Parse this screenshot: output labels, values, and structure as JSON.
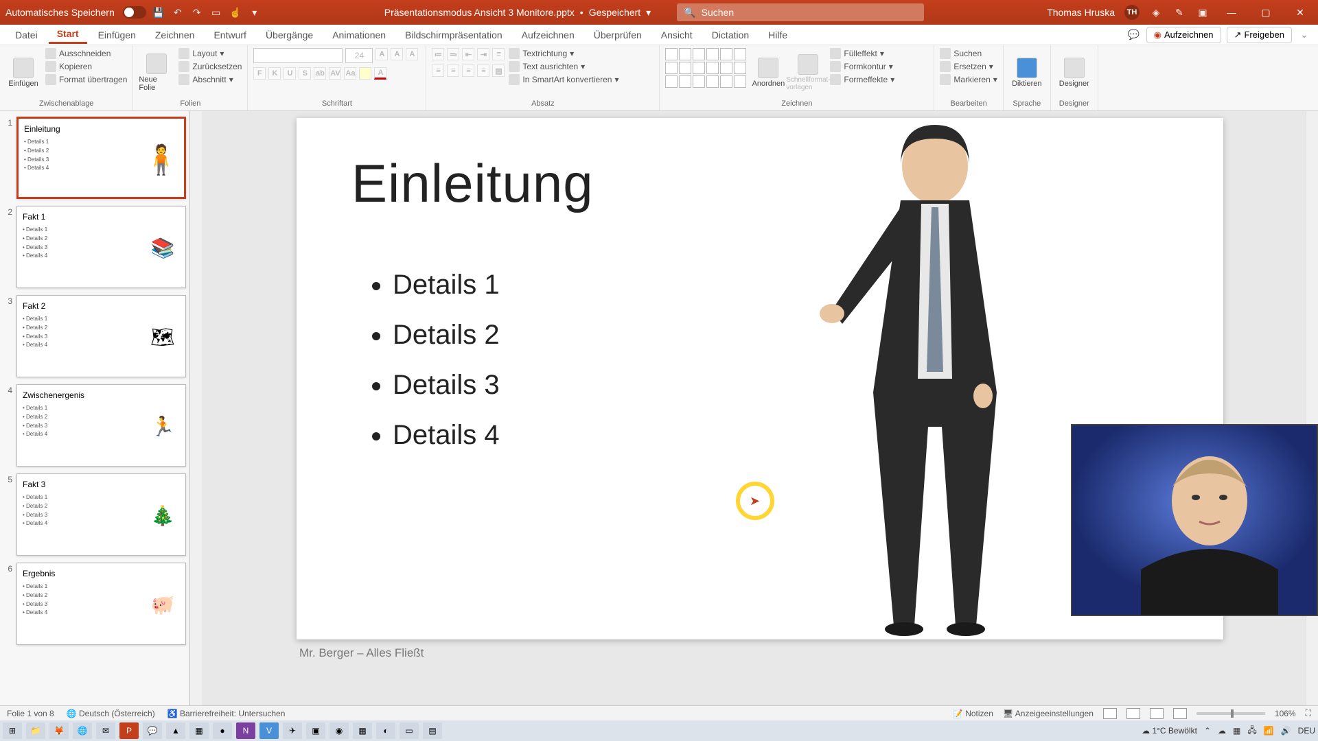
{
  "titlebar": {
    "autosave_label": "Automatisches Speichern",
    "filename": "Präsentationsmodus Ansicht 3 Monitore.pptx",
    "saved_status": "Gespeichert",
    "search_placeholder": "Suchen",
    "user_name": "Thomas Hruska",
    "user_initials": "TH"
  },
  "menu": {
    "tabs": [
      "Datei",
      "Start",
      "Einfügen",
      "Zeichnen",
      "Entwurf",
      "Übergänge",
      "Animationen",
      "Bildschirmpräsentation",
      "Aufzeichnen",
      "Überprüfen",
      "Ansicht",
      "Dictation",
      "Hilfe"
    ],
    "active_index": 1,
    "record": "Aufzeichnen",
    "share": "Freigeben"
  },
  "ribbon": {
    "clipboard": {
      "paste": "Einfügen",
      "cut": "Ausschneiden",
      "copy": "Kopieren",
      "format": "Format übertragen",
      "label": "Zwischenablage"
    },
    "slides": {
      "new": "Neue Folie",
      "layout": "Layout",
      "reset": "Zurücksetzen",
      "section": "Abschnitt",
      "label": "Folien"
    },
    "font": {
      "size": "24",
      "label": "Schriftart"
    },
    "paragraph": {
      "textdir": "Textrichtung",
      "align": "Text ausrichten",
      "smartart": "In SmartArt konvertieren",
      "label": "Absatz"
    },
    "drawing": {
      "arrange": "Anordnen",
      "quickstyles": "Schnellformat-vorlagen",
      "fill": "Fülleffekt",
      "outline": "Formkontur",
      "effects": "Formeffekte",
      "label": "Zeichnen"
    },
    "editing": {
      "find": "Suchen",
      "replace": "Ersetzen",
      "select": "Markieren",
      "label": "Bearbeiten"
    },
    "voice": {
      "dictate": "Diktieren",
      "label": "Sprache"
    },
    "designer": {
      "designer": "Designer",
      "label": "Designer"
    }
  },
  "thumbnails": [
    {
      "num": "1",
      "title": "Einleitung",
      "bullets": [
        "Details 1",
        "Details 2",
        "Details 3",
        "Details 4"
      ],
      "icon": "person"
    },
    {
      "num": "2",
      "title": "Fakt 1",
      "bullets": [
        "Details 1",
        "Details 2",
        "Details 3",
        "Details 4"
      ],
      "icon": "stack"
    },
    {
      "num": "3",
      "title": "Fakt 2",
      "bullets": [
        "Details 1",
        "Details 2",
        "Details 3",
        "Details 4"
      ],
      "icon": "map"
    },
    {
      "num": "4",
      "title": "Zwischenergenis",
      "bullets": [
        "Details 1",
        "Details 2",
        "Details 3",
        "Details 4"
      ],
      "icon": "runner"
    },
    {
      "num": "5",
      "title": "Fakt 3",
      "bullets": [
        "Details 1",
        "Details 2",
        "Details 3",
        "Details 4"
      ],
      "icon": "tree"
    },
    {
      "num": "6",
      "title": "Ergebnis",
      "bullets": [
        "Details 1",
        "Details 2",
        "Details 3",
        "Details 4"
      ],
      "icon": "pig"
    }
  ],
  "slide": {
    "title": "Einleitung",
    "bullets": [
      "Details 1",
      "Details 2",
      "Details 3",
      "Details 4"
    ],
    "notes": "Mr. Berger – Alles Fließt"
  },
  "status": {
    "slide_info": "Folie 1 von 8",
    "language": "Deutsch (Österreich)",
    "accessibility": "Barrierefreiheit: Untersuchen",
    "notes": "Notizen",
    "display": "Anzeigeeinstellungen",
    "zoom": "106%"
  },
  "taskbar": {
    "weather": "1°C  Bewölkt",
    "lang": "DEU"
  }
}
